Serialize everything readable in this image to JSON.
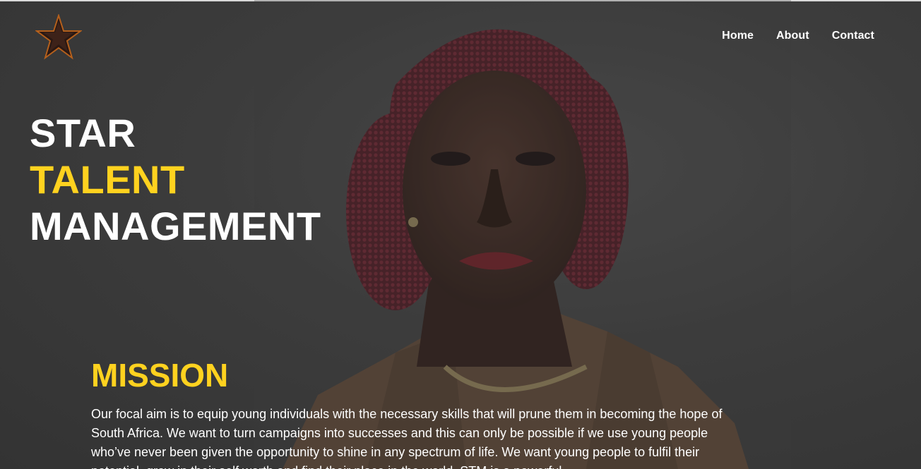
{
  "brand": {
    "logo_icon": "star-logo-icon"
  },
  "nav": {
    "items": [
      {
        "label": "Home"
      },
      {
        "label": "About"
      },
      {
        "label": "Contact"
      }
    ]
  },
  "hero": {
    "line1": "STAR",
    "line2": "TALENT",
    "line3": "MANAGEMENT"
  },
  "mission": {
    "title": "MISSION",
    "text": "Our focal aim is to equip young individuals with the necessary skills that will prune them in becoming the hope of South Africa. We want to turn campaigns into successes and this can only be possible if we use young people who’ve never been given the opportunity to shine in any spectrum of life. We want young people to fulfil their potential, grow in their self worth and find their place in the world. STM is a powerful"
  },
  "colors": {
    "accent": "#ffd21f",
    "background": "#3b3b3b",
    "text": "#ffffff"
  }
}
